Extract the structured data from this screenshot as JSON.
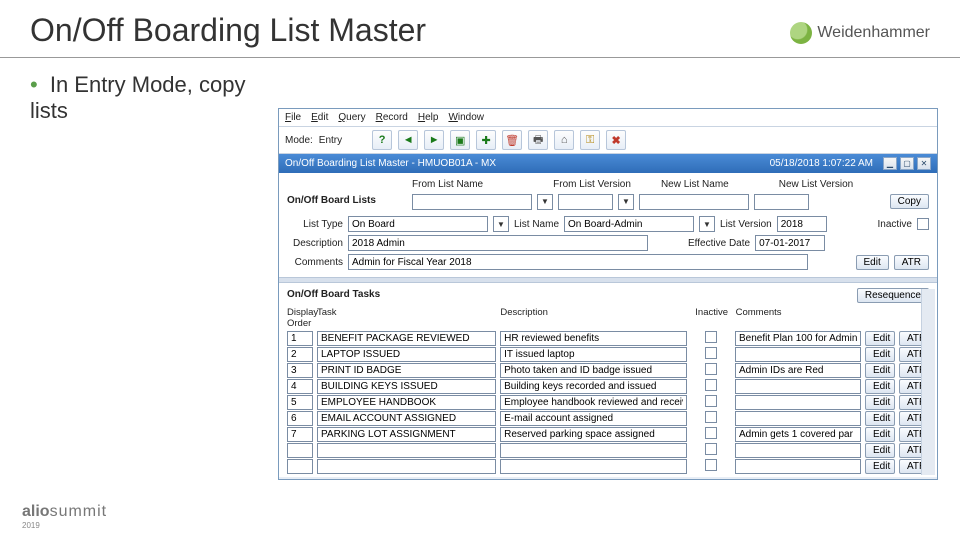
{
  "slide": {
    "title": "On/Off Boarding List Master",
    "bullet": "In Entry Mode, copy lists",
    "brand": "Weidenhammer",
    "footer_alio": "alio",
    "footer_summit": "summit",
    "footer_year": "2019"
  },
  "menubar": {
    "file": "File",
    "edit": "Edit",
    "query": "Query",
    "record": "Record",
    "help": "Help",
    "window": "Window"
  },
  "toolbar": {
    "mode_label": "Mode:",
    "mode_value": "Entry"
  },
  "subwin": {
    "title_left": "On/Off Boarding List Master - HMUOB01A - MX",
    "title_right": "05/18/2018 1:07:22 AM"
  },
  "lists": {
    "section": "On/Off Board Lists",
    "from_list_name": "From List Name",
    "from_list_version": "From List Version",
    "new_list_name": "New List Name",
    "new_list_version": "New List Version",
    "copy": "Copy",
    "list_type_lbl": "List Type",
    "list_type_val": "On Board",
    "list_name_lbl": "List Name",
    "list_name_val": "On Board-Admin",
    "list_version_lbl": "List Version",
    "list_version_val": "2018",
    "inactive_lbl": "Inactive",
    "description_lbl": "Description",
    "description_val": "2018 Admin",
    "eff_date_lbl": "Effective Date",
    "eff_date_val": "07-01-2017",
    "comments_lbl": "Comments",
    "comments_val": "Admin for Fiscal Year 2018",
    "edit": "Edit",
    "atr": "ATR"
  },
  "tasks": {
    "section": "On/Off Board Tasks",
    "resequence": "Resequence",
    "h_display": "Display",
    "h_order": "Order",
    "h_task": "Task",
    "h_desc": "Description",
    "h_inactive": "Inactive",
    "h_comments": "Comments",
    "rows": [
      {
        "order": "1",
        "task": "BENEFIT PACKAGE REVIEWED",
        "desc": "HR reviewed benefits",
        "comments": "Benefit Plan 100 for Admin"
      },
      {
        "order": "2",
        "task": "LAPTOP ISSUED",
        "desc": "IT issued laptop",
        "comments": ""
      },
      {
        "order": "3",
        "task": "PRINT ID BADGE",
        "desc": "Photo taken and ID badge issued",
        "comments": "Admin IDs are Red"
      },
      {
        "order": "4",
        "task": "BUILDING KEYS ISSUED",
        "desc": "Building keys recorded and issued",
        "comments": ""
      },
      {
        "order": "5",
        "task": "EMPLOYEE HANDBOOK",
        "desc": "Employee handbook reviewed and received",
        "comments": ""
      },
      {
        "order": "6",
        "task": "EMAIL ACCOUNT ASSIGNED",
        "desc": "E-mail account assigned",
        "comments": ""
      },
      {
        "order": "7",
        "task": "PARKING LOT ASSIGNMENT",
        "desc": "Reserved parking space assigned",
        "comments": "Admin gets 1 covered par"
      },
      {
        "order": "",
        "task": "",
        "desc": "",
        "comments": ""
      },
      {
        "order": "",
        "task": "",
        "desc": "",
        "comments": ""
      }
    ],
    "edit": "Edit",
    "atr": "ATR"
  }
}
